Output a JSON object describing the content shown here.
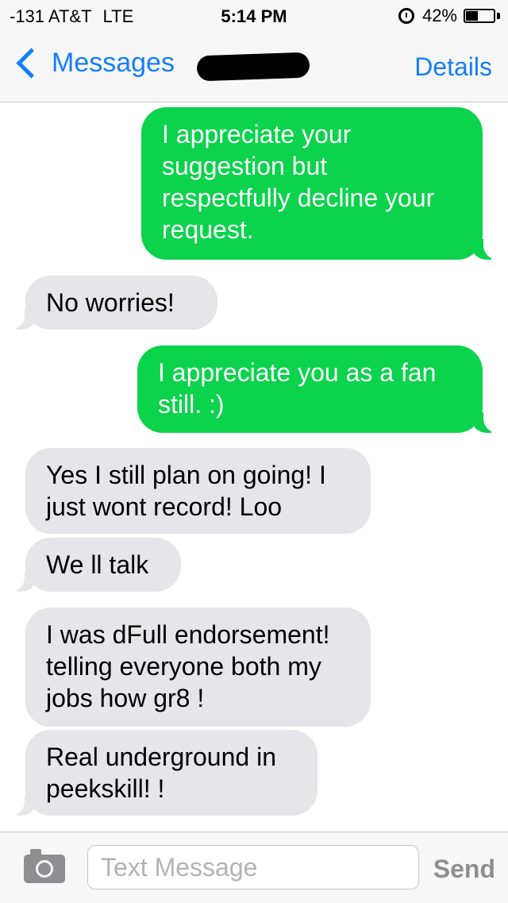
{
  "status_bar": {
    "carrier": "-131 AT&T",
    "network": "LTE",
    "time": "5:14 PM",
    "battery_percent": "42%",
    "battery_level": 0.42
  },
  "nav": {
    "back_label": "Messages",
    "details_label": "Details"
  },
  "messages": [
    {
      "direction": "outgoing",
      "text": "I appreciate your suggestion but respectfully decline your request."
    },
    {
      "direction": "incoming",
      "text": "No worries!"
    },
    {
      "direction": "outgoing",
      "text": "I appreciate you as a fan still. :)"
    },
    {
      "direction": "incoming",
      "text": "Yes I still plan on going! I just wont record!  Loo"
    },
    {
      "direction": "incoming",
      "text": "We ll talk"
    },
    {
      "direction": "incoming",
      "text": "I was dFull endorsement! telling everyone  both my jobs  how gr8 !"
    },
    {
      "direction": "incoming",
      "text": "Real underground in peekskill! !"
    }
  ],
  "input": {
    "placeholder": "Text Message",
    "value": "",
    "send_label": "Send"
  },
  "colors": {
    "ios_blue": "#147efb",
    "outgoing_bubble": "#0bd34c",
    "incoming_bubble": "#e5e5ea"
  }
}
